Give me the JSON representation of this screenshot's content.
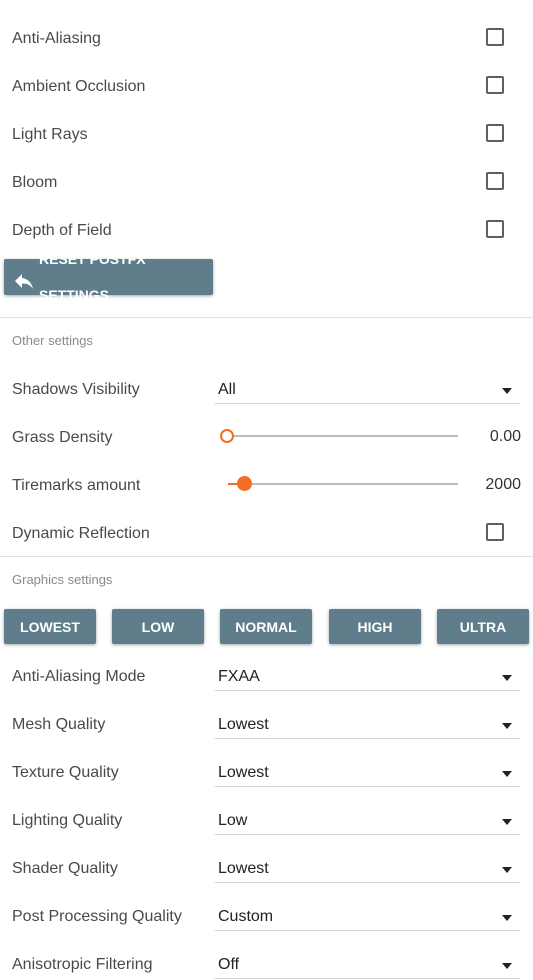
{
  "postfx": {
    "items": [
      {
        "label": "Anti-Aliasing",
        "checked": false
      },
      {
        "label": "Ambient Occlusion",
        "checked": false
      },
      {
        "label": "Light Rays",
        "checked": false
      },
      {
        "label": "Bloom",
        "checked": false
      },
      {
        "label": "Depth of Field",
        "checked": false
      }
    ],
    "reset_label": "RESET POSTFX SETTINGS"
  },
  "other": {
    "title": "Other settings",
    "shadows": {
      "label": "Shadows Visibility",
      "value": "All"
    },
    "grass": {
      "label": "Grass Density",
      "value_text": "0.00",
      "fraction": 0.0
    },
    "tiremarks": {
      "label": "Tiremarks amount",
      "value_text": "2000",
      "fraction": 0.076
    },
    "reflection": {
      "label": "Dynamic Reflection",
      "checked": false
    }
  },
  "graphics": {
    "title": "Graphics settings",
    "presets": [
      "LOWEST",
      "LOW",
      "NORMAL",
      "HIGH",
      "ULTRA"
    ],
    "selects": [
      {
        "label": "Anti-Aliasing Mode",
        "value": "FXAA"
      },
      {
        "label": "Mesh Quality",
        "value": "Lowest"
      },
      {
        "label": "Texture Quality",
        "value": "Lowest"
      },
      {
        "label": "Lighting Quality",
        "value": "Low"
      },
      {
        "label": "Shader Quality",
        "value": "Lowest"
      },
      {
        "label": "Post Processing Quality",
        "value": "Custom"
      },
      {
        "label": "Anisotropic Filtering",
        "value": "Off"
      }
    ]
  },
  "colors": {
    "accent": "#f26f21",
    "button": "#5f7d8a"
  },
  "icons": {
    "reset": "undo-icon",
    "dropdown": "triangle-down-icon"
  }
}
